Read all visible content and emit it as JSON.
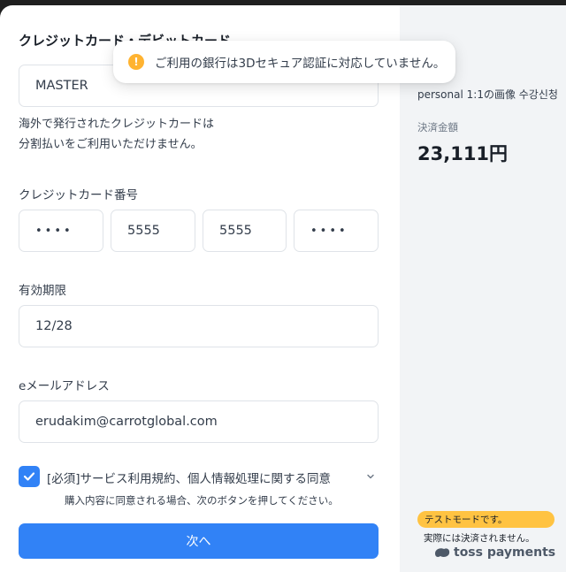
{
  "form": {
    "section_title": "クレジットカード・デビットカード",
    "card_company": "MASTER",
    "installment_note_line1": "海外で発行されたクレジットカードは",
    "installment_note_line2": "分割払いをご利用いただけません。",
    "card_number_label": "クレジットカード番号",
    "card_number": [
      "••••",
      "5555",
      "5555",
      "••••"
    ],
    "expiry_label": "有効期限",
    "expiry_value": "12/28",
    "email_label": "eメールアドレス",
    "email_value": "erudakim@carrotglobal.com",
    "agree_label": "[必須]サービス利用規約、個人情報処理に関する同意",
    "agree_checked": true,
    "agree_subnote": "購入内容に同意される場合、次のボタンを押してください。",
    "next_button": "次へ"
  },
  "toast": {
    "message": "ご利用の銀行は3Dセキュア認証に対応していません。",
    "icon": "exclamation-icon"
  },
  "summary": {
    "order_name": "personal 1:1の画像 수강신청",
    "amount_label": "決済金額",
    "amount": "23,111円",
    "test_badge": "テストモードです。",
    "test_note": "実際には決済されません。",
    "brand": "toss payments"
  },
  "colors": {
    "primary": "#3182f6",
    "warning": "#ffb331",
    "test_badge": "#ffc342",
    "side_panel": "#f2f4f6"
  }
}
